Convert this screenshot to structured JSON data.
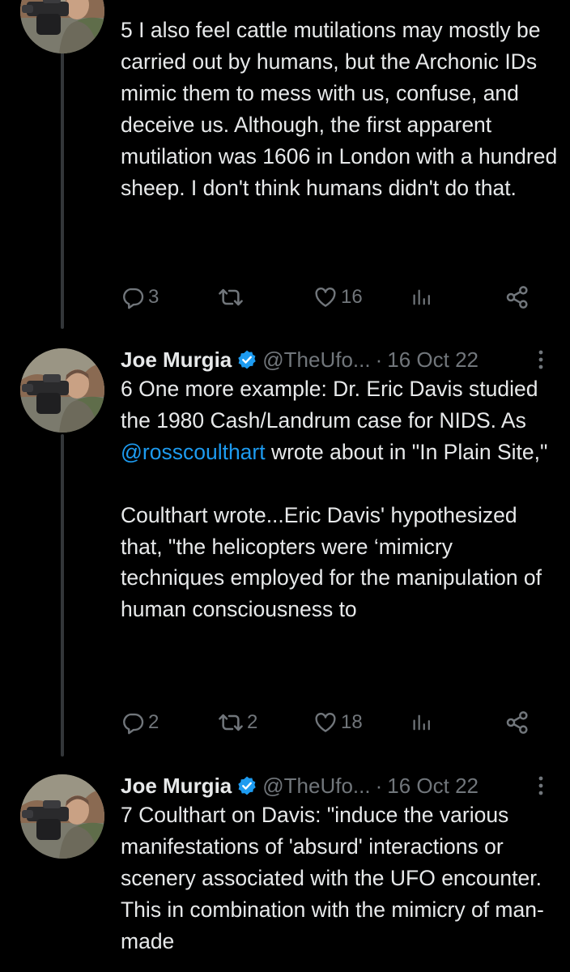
{
  "tweets": [
    {
      "author": "",
      "handle": "",
      "date": "",
      "paragraphs": [
        "5 I also feel cattle mutilations may mostly be carried out by humans, but the Archonic IDs mimic them to mess with us, confuse, and deceive us. Although, the first apparent mutilation was 1606 in London with a hundred sheep. I don't think humans didn't do that."
      ],
      "replies": "3",
      "retweets": "",
      "likes": "16"
    },
    {
      "author": "Joe Murgia",
      "handle": "@TheUfo...",
      "separator": "·",
      "date": "16 Oct 22",
      "paragraph1_pre": "6 One more example: Dr. Eric Davis studied the 1980 Cash/Landrum case for NIDS. As ",
      "mention": "@rosscoulthart",
      "paragraph1_post": " wrote about in \"In Plain Site,\"",
      "paragraph2": "Coulthart wrote...Eric Davis' hypothesized that, \"the helicopters were ‘mimicry techniques employed for the manipulation of human consciousness to",
      "replies": "2",
      "retweets": "2",
      "likes": "18"
    },
    {
      "author": "Joe Murgia",
      "handle": "@TheUfo...",
      "separator": "·",
      "date": "16 Oct 22",
      "paragraphs": [
        "7 Coulthart on Davis: \"induce the various manifestations of 'absurd' interactions or scenery associated with the UFO encounter. This in combination with the mimicry of man-made"
      ]
    }
  ],
  "icons": {
    "reply": "reply-icon",
    "retweet": "retweet-icon",
    "like": "heart-icon",
    "views": "analytics-icon",
    "share": "share-icon",
    "verified": "verified-badge-icon",
    "more": "more-options-icon"
  },
  "colors": {
    "background": "#000000",
    "text": "#e7e9ea",
    "muted": "#71767b",
    "link": "#1d9bf0",
    "verified": "#1d9bf0",
    "thread_line": "#333639"
  }
}
